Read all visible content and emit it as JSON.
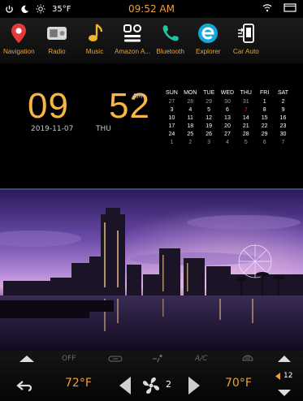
{
  "status": {
    "weather_temp": "35°F",
    "clock": "09:52 AM",
    "icons": [
      "power-icon",
      "night-mode-icon",
      "brightness-icon",
      "wifi-icon",
      "window-icon"
    ]
  },
  "dock": {
    "apps": [
      {
        "label": "Navigation",
        "icon": "map-pin-icon",
        "color": "#e23b3b"
      },
      {
        "label": "Radio",
        "icon": "radio-icon",
        "color": "#d9d9d9"
      },
      {
        "label": "Music",
        "icon": "music-note-icon",
        "color": "#f0b428"
      },
      {
        "label": "Amazon A...",
        "icon": "grid-icon",
        "color": "#ffffff"
      },
      {
        "label": "Bluetooth",
        "icon": "phone-icon",
        "color": "#1fc4a0"
      },
      {
        "label": "Explorer",
        "icon": "explorer-icon",
        "color": "#12a8d8"
      },
      {
        "label": "Car Auto",
        "icon": "car-auto-icon",
        "color": "#ffffff"
      }
    ]
  },
  "clock_widget": {
    "hour": "09",
    "minute": "52",
    "ampm": "AM",
    "date": "2019-11-07",
    "weekday": "THU"
  },
  "calendar": {
    "headers": [
      "SUN",
      "MON",
      "TUE",
      "WED",
      "THU",
      "FRI",
      "SAT"
    ],
    "weeks": [
      [
        "27",
        "28",
        "29",
        "30",
        "31",
        "1",
        "2"
      ],
      [
        "3",
        "4",
        "5",
        "6",
        "7",
        "8",
        "9"
      ],
      [
        "10",
        "11",
        "12",
        "13",
        "14",
        "15",
        "16"
      ],
      [
        "17",
        "18",
        "19",
        "20",
        "21",
        "22",
        "23"
      ],
      [
        "24",
        "25",
        "26",
        "27",
        "28",
        "29",
        "30"
      ],
      [
        "1",
        "2",
        "3",
        "4",
        "5",
        "6",
        "7"
      ]
    ],
    "dim_cells": [
      "0-0",
      "0-1",
      "0-2",
      "0-3",
      "0-4",
      "5-0",
      "5-1",
      "5-2",
      "5-3",
      "5-4",
      "5-5",
      "5-6"
    ],
    "today_cell": "1-4"
  },
  "climate": {
    "off_label": "OFF",
    "ac_label": "A/C",
    "left_temp": "72°F",
    "right_temp": "70°F",
    "fan_speed": "2",
    "volume": "12",
    "accent": "#f0a030"
  }
}
